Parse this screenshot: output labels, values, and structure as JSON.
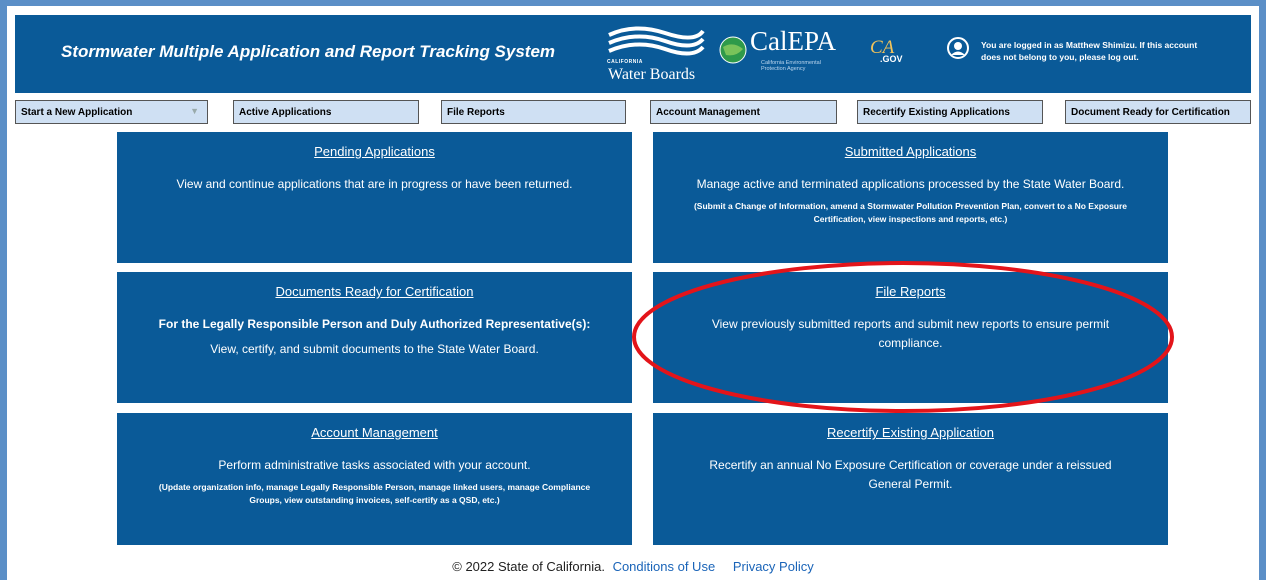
{
  "header": {
    "title": "Stormwater Multiple Application and Report Tracking System",
    "logos": {
      "water_boards_small": "CALIFORNIA",
      "water_boards": "Water Boards",
      "calepa": "CalEPA",
      "calepa_sub": "California Environmental Protection Agency",
      "cagov_ca": "CA",
      "cagov_gov": ".GOV"
    },
    "login_message": "You are logged in as Matthew Shimizu. If this account does not belong to you, please log out."
  },
  "nav": {
    "items": [
      {
        "label": "Start a New Application"
      },
      {
        "label": "Active Applications"
      },
      {
        "label": "File Reports"
      },
      {
        "label": "Account Management"
      },
      {
        "label": "Recertify Existing Applications"
      },
      {
        "label": "Document Ready for Certification"
      }
    ]
  },
  "tiles": {
    "pending": {
      "title": "Pending Applications",
      "desc": "View and continue applications that are in progress or have been returned."
    },
    "submitted": {
      "title": "Submitted Applications",
      "desc": "Manage active and terminated applications processed by the State Water Board.",
      "note": "(Submit a Change of Information, amend a Stormwater Pollution Prevention Plan, convert to a No Exposure Certification, view inspections and reports, etc.)"
    },
    "documents": {
      "title": "Documents Ready for Certification",
      "bold": "For the Legally Responsible Person and Duly Authorized Representative(s):",
      "desc": "View, certify, and submit documents to the State Water Board."
    },
    "file_reports": {
      "title": "File Reports",
      "desc": "View previously submitted reports and submit new reports to ensure permit compliance."
    },
    "account": {
      "title": "Account Management",
      "desc": "Perform administrative tasks associated with your account.",
      "note": "(Update organization info, manage Legally Responsible Person, manage linked users, manage Compliance Groups, view outstanding invoices, self-certify as a QSD, etc.)"
    },
    "recertify": {
      "title": "Recertify Existing Application",
      "desc": "Recertify an annual No Exposure Certification or coverage under a reissued General Permit."
    }
  },
  "footer": {
    "copyright": "© 2022 State of California.",
    "conditions": "Conditions of Use",
    "privacy": "Privacy Policy"
  },
  "colors": {
    "header_bg": "#0a5a98",
    "nav_bg": "#cfe0f3",
    "frame": "#5b8fc7",
    "annotation": "#e3141a"
  }
}
